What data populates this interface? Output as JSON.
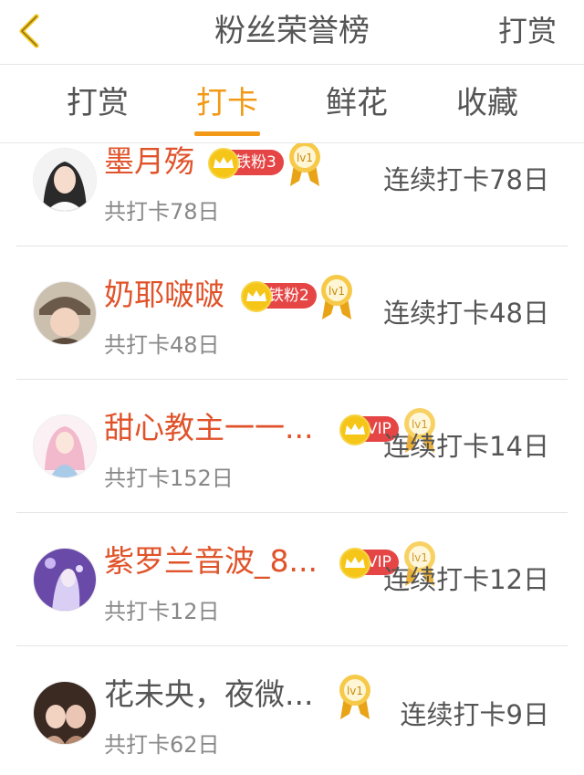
{
  "header": {
    "title": "粉丝荣誉榜",
    "right_action": "打赏",
    "back_icon": "chevron-left-icon",
    "icon_color": "#f5c518"
  },
  "tabs": [
    {
      "label": "打赏",
      "active": false
    },
    {
      "label": "打卡",
      "active": true
    },
    {
      "label": "鲜花",
      "active": false
    },
    {
      "label": "收藏",
      "active": false
    }
  ],
  "colors": {
    "accent": "#f29a17",
    "name_red": "#e0532a",
    "badge_red": "#e54545",
    "crown_gold": "#f5c518"
  },
  "list": [
    {
      "name": "墨月殇",
      "badge": "铁粉3",
      "medal": "lv1",
      "streak": "连续打卡78日",
      "total": "共打卡78日"
    },
    {
      "name": "奶耶啵啵",
      "badge": "铁粉2",
      "medal": "lv1",
      "streak": "连续打卡48日",
      "total": "共打卡48日"
    },
    {
      "name": "甜心教主一一...",
      "badge": "VIP",
      "medal": "lv1",
      "streak": "连续打卡14日",
      "total": "共打卡152日"
    },
    {
      "name": "紫罗兰音波_8...",
      "badge": "VIP",
      "medal": "lv1",
      "streak": "连续打卡12日",
      "total": "共打卡12日"
    },
    {
      "name": "花未央，夜微...",
      "badge": "",
      "medal": "lv1",
      "streak": "连续打卡9日",
      "total": "共打卡62日"
    }
  ]
}
